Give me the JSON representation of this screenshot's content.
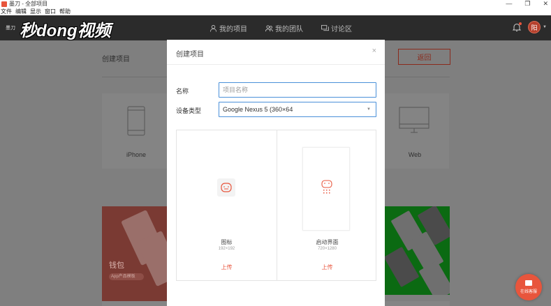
{
  "window": {
    "title": "墨刀 - 全部项目",
    "controls": [
      "—",
      "❐",
      "✕"
    ]
  },
  "menu": [
    "文件",
    "编辑",
    "显示",
    "窗口",
    "帮助"
  ],
  "topnav": {
    "brand": "墨刀",
    "watermark": "秒dong视频",
    "links": [
      "我的项目",
      "我的团队",
      "讨论区"
    ],
    "avatar_initial": "阳"
  },
  "background": {
    "title": "创建项目",
    "back_button": "返回",
    "cards": [
      "iPhone",
      "Web"
    ],
    "wallet_label": "钱包",
    "wallet_tag": "App产品模板"
  },
  "modal": {
    "title": "创建项目",
    "close": "×",
    "name_label": "名称",
    "name_placeholder": "项目名称",
    "device_label": "设备类型",
    "device_value": "Google Nexus 5 (360×64",
    "uploads": [
      {
        "label": "图标",
        "size": "192×192",
        "action": "上传"
      },
      {
        "label": "启动界面",
        "size": "720×1280",
        "action": "上传"
      }
    ]
  },
  "chat": {
    "label": "在线客服"
  },
  "colors": {
    "accent": "#e8553c",
    "focus": "#4a90d9"
  }
}
